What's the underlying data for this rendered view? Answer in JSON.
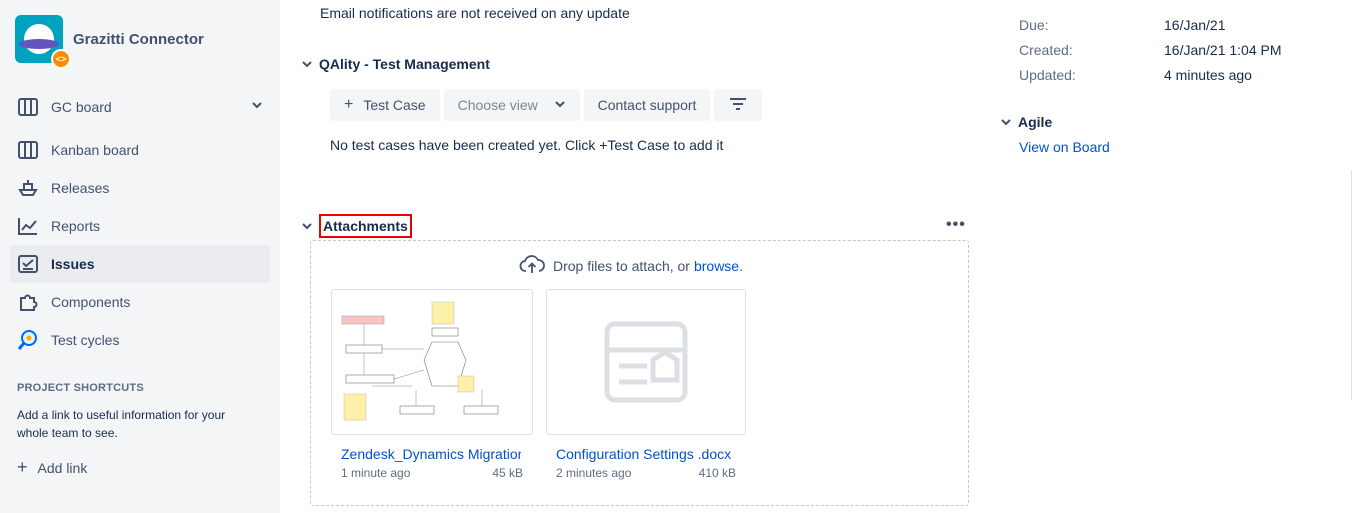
{
  "project": {
    "name": "Grazitti Connector",
    "badge": "<>"
  },
  "sidebar": {
    "board": {
      "label": "GC board"
    },
    "items": [
      {
        "label": "Kanban board",
        "icon": "kanban-icon",
        "active": false
      },
      {
        "label": "Releases",
        "icon": "ship-icon",
        "active": false
      },
      {
        "label": "Reports",
        "icon": "chart-icon",
        "active": false
      },
      {
        "label": "Issues",
        "icon": "issues-icon",
        "active": true
      },
      {
        "label": "Components",
        "icon": "puzzle-icon",
        "active": false
      },
      {
        "label": "Test cycles",
        "icon": "test-cycle-icon",
        "active": false
      }
    ],
    "shortcuts": {
      "title": "PROJECT SHORTCUTS",
      "description": "Add a link to useful information for your whole team to see.",
      "add_link": "Add link"
    }
  },
  "main": {
    "email_note": "Email notifications are not received on any update",
    "qality": {
      "title": "QAlity - Test Management",
      "test_case_label": "Test Case",
      "choose_view_placeholder": "Choose view",
      "contact_support_label": "Contact support",
      "empty_message": "No test cases have been created yet. Click +Test Case to add it"
    },
    "attachments": {
      "title": "Attachments",
      "drop_text": "Drop files to attach, or",
      "browse_label": "browse.",
      "files": [
        {
          "name": "Zendesk_Dynamics Migration",
          "time": "1 minute ago",
          "size": "45 kB"
        },
        {
          "name": "Configuration Settings .docx",
          "time": "2 minutes ago",
          "size": "410 kB"
        }
      ]
    }
  },
  "details": {
    "due_label": "Due:",
    "due_value": "16/Jan/21",
    "created_label": "Created:",
    "created_value": "16/Jan/21 1:04 PM",
    "updated_label": "Updated:",
    "updated_value": "4 minutes ago"
  },
  "agile": {
    "title": "Agile",
    "view_on_board": "View on Board"
  },
  "colors": {
    "link": "#0052cc",
    "sidebar_bg": "#f4f5f7",
    "active_bg": "#ebecf0",
    "highlight": "#ee0000"
  }
}
